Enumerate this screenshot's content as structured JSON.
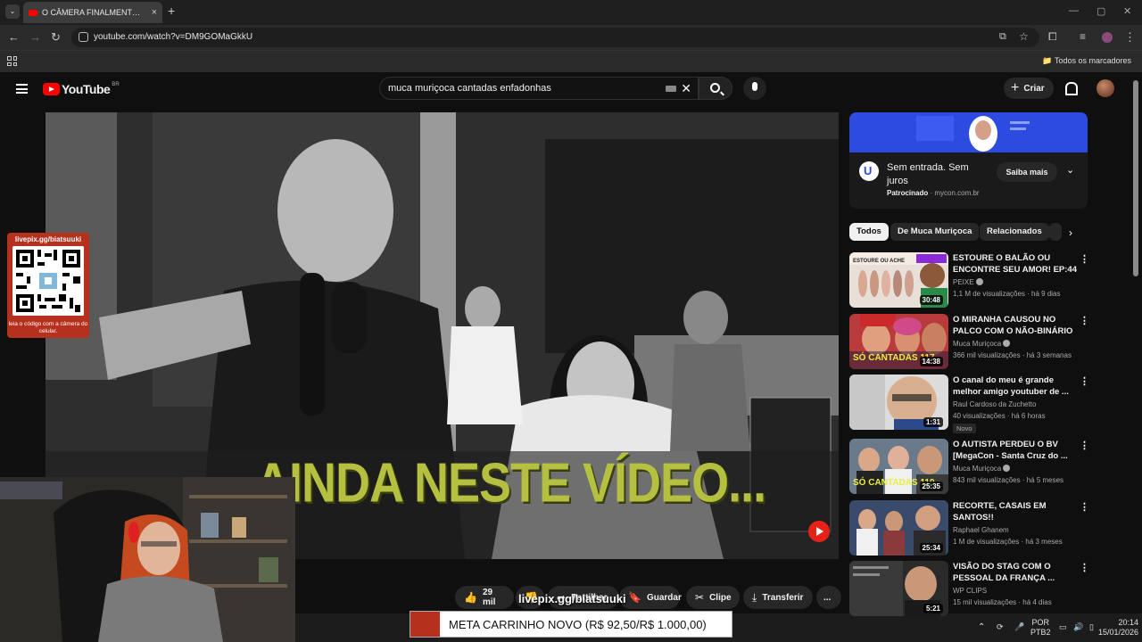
{
  "browser": {
    "tab_title": "O CÂMERA FINALMENTE BEIJO...",
    "url": "youtube.com/watch?v=DM9GOMaGkkU",
    "bookmarks_label": "Todos os marcadores"
  },
  "youtube": {
    "logo_text": "YouTube",
    "country_code": "BR",
    "search_query": "muca muriçoca cantadas enfadonhas",
    "create_label": "Criar"
  },
  "video": {
    "overlay_text": "AINDA NESTE VÍDEO...",
    "qr_top": "livepix.gg/biatsuuki",
    "qr_bottom": "leia o código com a câmera do celular."
  },
  "actions": {
    "likes": "29 mil",
    "share": "Partilhar",
    "save": "Guardar",
    "clip": "Clipe",
    "download": "Transferir",
    "more": "..."
  },
  "stream": {
    "watermark": "livepix.gg/biatsuuki",
    "meta": "META CARRINHO NOVO (R$ 92,50/R$ 1.000,00)"
  },
  "ad": {
    "title": "Sem entrada. Sem juros",
    "sponsored": "Patrocinado",
    "domain": "mycon.com.br",
    "button": "Saiba mais"
  },
  "chips": [
    "Todos",
    "De Muca Muriçoca",
    "Relacionados"
  ],
  "recommendations": [
    {
      "title": "ESTOURE O BALÃO OU ENCONTRE SEU AMOR! EP:44",
      "channel": "PEIXE",
      "stats": "1,1 M de visualizações · há 9 dias",
      "duration": "30:48",
      "thumb_text": "ESTOURE OU ACHE"
    },
    {
      "title": "O MIRANHA CAUSOU NO PALCO COM O NÃO-BINÁRIO",
      "channel": "Muca Muriçoca",
      "stats": "366 mil visualizações · há 3 semanas",
      "duration": "14:38",
      "thumb_text": "SÓ CANTADAS 117"
    },
    {
      "title": "O canal do meu é grande melhor amigo youtuber de ...",
      "channel": "Raul Cardoso da Zuchetto",
      "stats": "40 visualizações · há 6 horas",
      "duration": "1:31",
      "badge": "Novo"
    },
    {
      "title": "O AUTISTA PERDEU O BV [MegaCon - Santa Cruz do ...",
      "channel": "Muca Muriçoca",
      "stats": "843 mil visualizações · há 5 meses",
      "duration": "25:35",
      "thumb_text": "SÓ CANTADAS 110"
    },
    {
      "title": "RECORTE, CASAIS EM SANTOS!!",
      "channel": "Raphael Ghanem",
      "stats": "1 M de visualizações · há 3 meses",
      "duration": "25:34"
    },
    {
      "title": "VISÃO DO STAG COM O PESSOAL DA FRANÇA ...",
      "channel": "WP CLIPS",
      "stats": "15 mil visualizações · há 4 dias",
      "duration": "5:21"
    }
  ],
  "taskbar": {
    "lang_top": "POR",
    "lang_bottom": "PTB2",
    "time": "20:14",
    "date": "15/01/2026"
  }
}
